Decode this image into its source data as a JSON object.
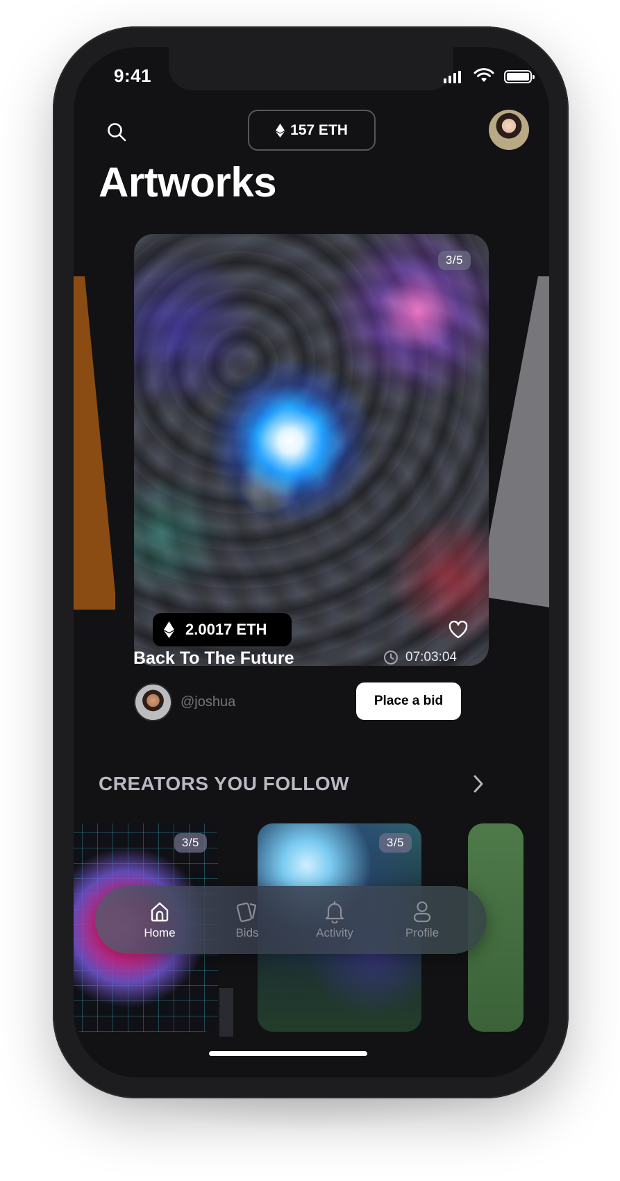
{
  "status_bar": {
    "time": "9:41"
  },
  "header": {
    "balance": "157 ETH",
    "title": "Artworks"
  },
  "featured": {
    "counter": "3/5",
    "price": "2.0017 ETH",
    "name": "Back To The Future",
    "time_left": "07:03:04",
    "creator_handle": "@joshua",
    "bid_label": "Place a bid"
  },
  "creators_section": {
    "title": "CREATORS YOU FOLLOW",
    "items": [
      {
        "counter": "3/5"
      },
      {
        "counter": "3/5"
      }
    ]
  },
  "tabbar": {
    "items": [
      {
        "label": "Home",
        "icon": "home-icon",
        "active": true
      },
      {
        "label": "Bids",
        "icon": "cards-icon",
        "active": false
      },
      {
        "label": "Activity",
        "icon": "bell-icon",
        "active": false
      },
      {
        "label": "Profile",
        "icon": "user-icon",
        "active": false
      }
    ]
  },
  "colors": {
    "background": "#121214",
    "accent_white": "#ffffff",
    "muted_text": "#75767c"
  }
}
